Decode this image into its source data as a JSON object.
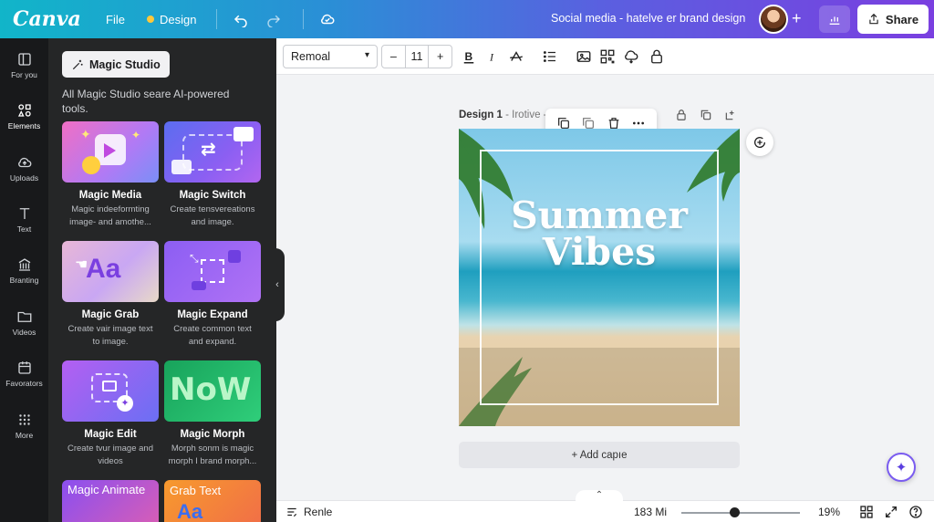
{
  "topbar": {
    "logo": "Canva",
    "file": "File",
    "design": "Design",
    "doc_title": "Social media - hatelve er brand design",
    "share": "Share"
  },
  "rail": {
    "items": [
      {
        "label": "For you",
        "icon": "home-icon"
      },
      {
        "label": "Elements",
        "icon": "shapes-icon"
      },
      {
        "label": "Uploads",
        "icon": "cloud-upload-icon"
      },
      {
        "label": "Text",
        "icon": "text-icon"
      },
      {
        "label": "Branting",
        "icon": "brand-icon"
      },
      {
        "label": "Videos",
        "icon": "folder-icon"
      },
      {
        "label": "Favorators",
        "icon": "calendar-icon"
      },
      {
        "label": "More",
        "icon": "grid-dots-icon"
      }
    ]
  },
  "panel": {
    "chip": "Magic Studio",
    "description": "All Magic Studio seare AI-powered tools.",
    "tiles": [
      {
        "name": "Magic Media",
        "desc1": "Magic indeeformting",
        "desc2": "image- and amothe..."
      },
      {
        "name": "Magic Switch",
        "desc1": "Create tensvereations",
        "desc2": "and image."
      },
      {
        "name": "Magic Grab",
        "desc1": "Create vair image text",
        "desc2": "to image."
      },
      {
        "name": "Magic Expand",
        "desc1": "Create common text",
        "desc2": "and expand."
      },
      {
        "name": "Magic Edit",
        "desc1": "Create tvur image and",
        "desc2": "videos"
      },
      {
        "name": "Magic Morph",
        "desc1": "Morph sonm is magic",
        "desc2": "morph I brand morph..."
      },
      {
        "name": "Magic Animate",
        "desc1": "",
        "desc2": ""
      },
      {
        "name": "Grab Text",
        "desc1": "",
        "desc2": ""
      }
    ],
    "grab_thumb_text": "Aa",
    "morph_thumb_text": "NoW"
  },
  "toolbar": {
    "font": "Remoal",
    "size": "11",
    "minus": "–",
    "plus": "+"
  },
  "canvas": {
    "design_label": "Design 1",
    "design_sub": " - Irotive -",
    "headline_1": "Summer",
    "headline_2": "Vibes",
    "add_caption": "+ Add capıe"
  },
  "bottombar": {
    "notes": "Renle",
    "duration": "183 Mi",
    "zoom": "19%",
    "zoom_level": 0.45
  }
}
